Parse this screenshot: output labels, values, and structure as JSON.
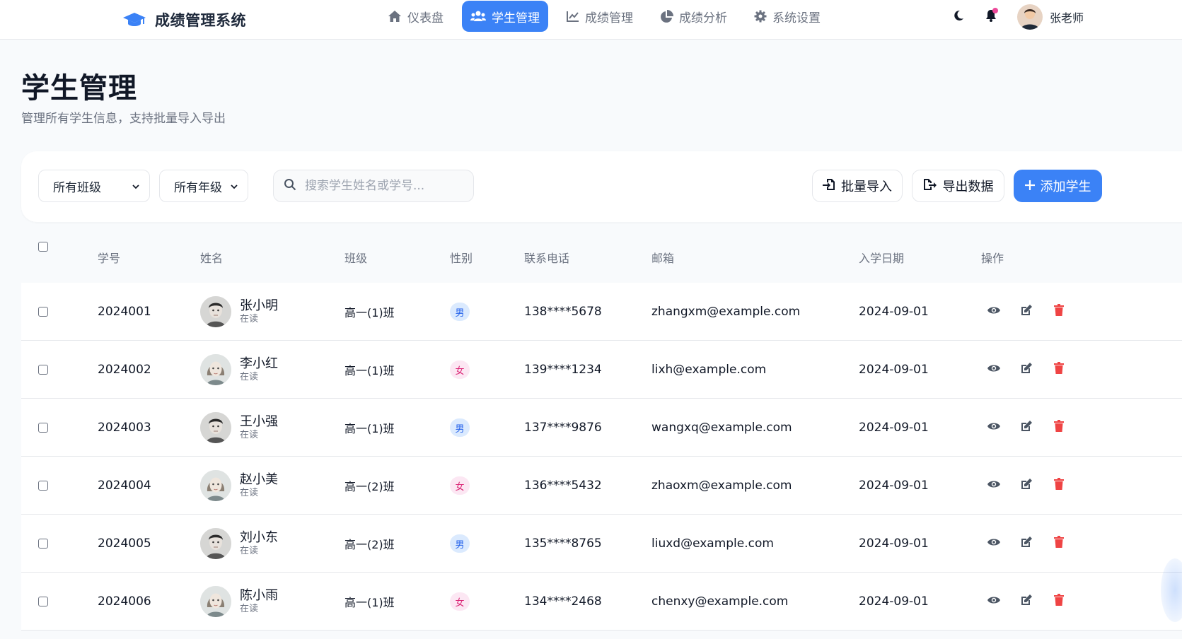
{
  "app": {
    "title": "成绩管理系统"
  },
  "nav": [
    {
      "label": "仪表盘",
      "icon": "home-icon",
      "active": false
    },
    {
      "label": "学生管理",
      "icon": "users-icon",
      "active": true
    },
    {
      "label": "成绩管理",
      "icon": "line-chart-icon",
      "active": false
    },
    {
      "label": "成绩分析",
      "icon": "pie-chart-icon",
      "active": false
    },
    {
      "label": "系统设置",
      "icon": "gear-icon",
      "active": false
    }
  ],
  "user": {
    "name": "张老师"
  },
  "header": {
    "title": "学生管理",
    "subtitle": "管理所有学生信息，支持批量导入导出"
  },
  "filters": {
    "class_select": "所有班级",
    "grade_select": "所有年级",
    "search_placeholder": "搜索学生姓名或学号..."
  },
  "buttons": {
    "import": "批量导入",
    "export": "导出数据",
    "add": "添加学生"
  },
  "table": {
    "columns": [
      "学号",
      "姓名",
      "班级",
      "性别",
      "联系电话",
      "邮箱",
      "入学日期",
      "操作"
    ],
    "rows": [
      {
        "id": "2024001",
        "name": "张小明",
        "status": "在读",
        "class": "高一(1)班",
        "gender": "男",
        "phone": "138****5678",
        "email": "zhangxm@example.com",
        "date": "2024-09-01"
      },
      {
        "id": "2024002",
        "name": "李小红",
        "status": "在读",
        "class": "高一(1)班",
        "gender": "女",
        "phone": "139****1234",
        "email": "lixh@example.com",
        "date": "2024-09-01"
      },
      {
        "id": "2024003",
        "name": "王小强",
        "status": "在读",
        "class": "高一(1)班",
        "gender": "男",
        "phone": "137****9876",
        "email": "wangxq@example.com",
        "date": "2024-09-01"
      },
      {
        "id": "2024004",
        "name": "赵小美",
        "status": "在读",
        "class": "高一(2)班",
        "gender": "女",
        "phone": "136****5432",
        "email": "zhaoxm@example.com",
        "date": "2024-09-01"
      },
      {
        "id": "2024005",
        "name": "刘小东",
        "status": "在读",
        "class": "高一(2)班",
        "gender": "男",
        "phone": "135****8765",
        "email": "liuxd@example.com",
        "date": "2024-09-01"
      },
      {
        "id": "2024006",
        "name": "陈小雨",
        "status": "在读",
        "class": "高一(1)班",
        "gender": "女",
        "phone": "134****2468",
        "email": "chenxy@example.com",
        "date": "2024-09-01"
      }
    ]
  },
  "colors": {
    "primary": "#3b82f6",
    "danger": "#ef4444",
    "male_badge": "#dbeafe",
    "female_badge": "#fce7f3"
  }
}
